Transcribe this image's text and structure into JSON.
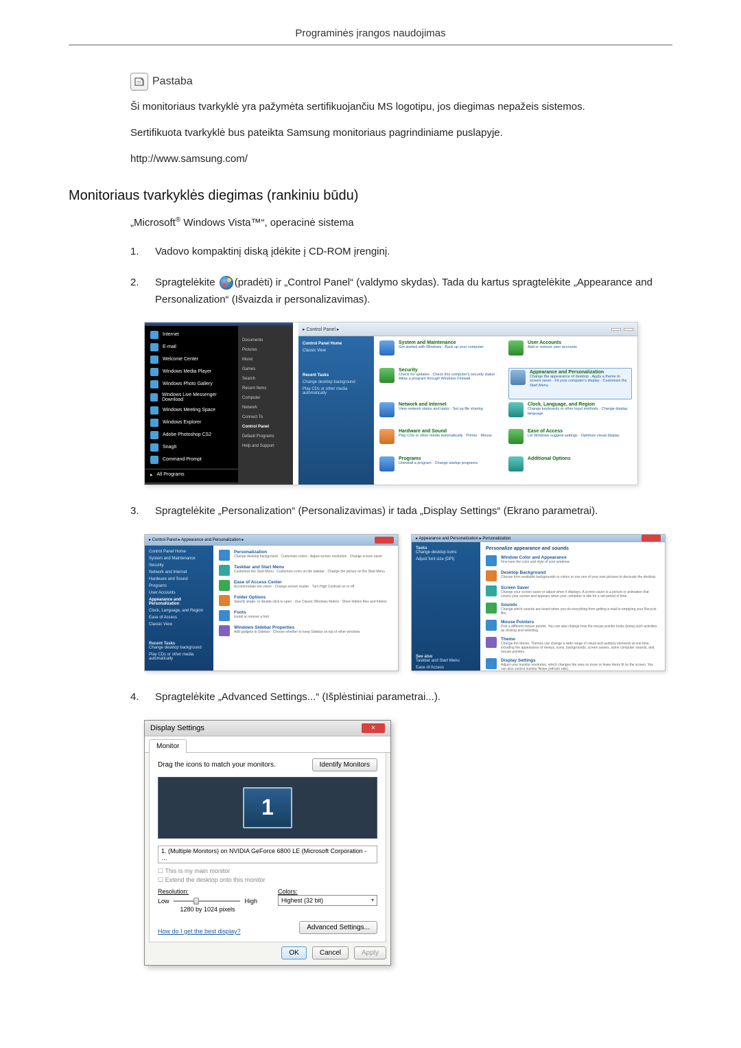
{
  "header": {
    "title": "Programinės įrangos naudojimas"
  },
  "note": {
    "label": "Pastaba",
    "p1": "Ši monitoriaus tvarkyklė yra pažymėta sertifikuojančiu MS logotipu, jos diegimas nepažeis sistemos.",
    "p2": "Sertifikuota tvarkyklė bus pateikta Samsung monitoriaus pagrindiniame puslapyje.",
    "p3": "http://www.samsung.com/"
  },
  "section": {
    "heading": "Monitoriaus tvarkyklės diegimas (rankiniu būdu)",
    "subheading_pre": "„Microsoft",
    "subheading_reg": "®",
    "subheading_mid": " Windows Vista™“, operacinė sistema"
  },
  "steps": {
    "s1": {
      "num": "1.",
      "text": "Vadovo kompaktinį diską įdėkite į CD-ROM įrenginį."
    },
    "s2": {
      "num": "2.",
      "before": "Spragtelėkite ",
      "after": "(pradėti) ir „Control Panel“ (valdymo skydas). Tada du kartus spragtelėkite „Appearance and Personalization“ (Išvaizda ir personalizavimas)."
    },
    "s3": {
      "num": "3.",
      "text": "Spragtelėkite „Personalization“ (Personalizavimas) ir tada „Display Settings“ (Ekrano parametrai)."
    },
    "s4": {
      "num": "4.",
      "text": "Spragtelėkite „Advanced Settings...“ (Išplėstiniai parametrai...)."
    }
  },
  "start_menu": {
    "col1": [
      "Internet",
      "E-mail",
      "Welcome Center",
      "Windows Media Player",
      "Windows Photo Gallery",
      "Windows Live Messenger Download",
      "Windows Meeting Space",
      "Windows Explorer",
      "Adobe Photoshop CS2",
      "SnagIt",
      "Command Prompt"
    ],
    "all": "All Programs",
    "col2": [
      "Documents",
      "Pictures",
      "Music",
      "Games",
      "Search",
      "Recent Items",
      "Computer",
      "Network",
      "Connect To",
      "Control Panel",
      "Default Programs",
      "Help and Support"
    ]
  },
  "cp": {
    "addr": "▸ Control Panel ▸",
    "side_head": "Control Panel Home",
    "side_classic": "Classic View",
    "side_recent": "Recent Tasks",
    "side_recent1": "Change desktop background",
    "side_recent2": "Play CDs or other media automatically",
    "cats": [
      {
        "title": "System and Maintenance",
        "sub": "Get started with Windows · Back up your computer"
      },
      {
        "title": "User Accounts",
        "sub": "Add or remove user accounts"
      },
      {
        "title": "Security",
        "sub": "Check for updates · Check this computer's security status · Allow a program through Windows Firewall"
      },
      {
        "title": "Appearance and Personalization",
        "sub": "Change the appearance of desktop · Apply a theme to screen saver · Fit your computer's display · Customize the Start Menu"
      },
      {
        "title": "Network and Internet",
        "sub": "View network status and tasks · Set up file sharing"
      },
      {
        "title": "Clock, Language, and Region",
        "sub": "Change keyboards or other input methods · Change display language"
      },
      {
        "title": "Hardware and Sound",
        "sub": "Play CDs or other media automatically · Printer · Mouse"
      },
      {
        "title": "Ease of Access",
        "sub": "Let Windows suggest settings · Optimize visual display"
      },
      {
        "title": "Programs",
        "sub": "Uninstall a program · Change startup programs"
      },
      {
        "title": "Additional Options",
        "sub": ""
      }
    ]
  },
  "pers_left": {
    "addr": "▸ Control Panel ▸ Appearance and Personalization ▸",
    "side": [
      "Control Panel Home",
      "System and Maintenance",
      "Security",
      "Network and Internet",
      "Hardware and Sound",
      "Programs",
      "User Accounts",
      "Appearance and Personalization",
      "Clock, Language, and Region",
      "Ease of Access",
      "Classic View"
    ],
    "see_head": "Recent Tasks",
    "see": [
      "Change desktop background",
      "Play CDs or other media automatically"
    ],
    "items": [
      {
        "t": "Personalization",
        "s": "Change desktop background · Customize colors · Adjust screen resolution · Change screen saver"
      },
      {
        "t": "Taskbar and Start Menu",
        "s": "Customize the Start Menu · Customize icons on the taskbar · Change the picture on the Start Menu"
      },
      {
        "t": "Ease of Access Center",
        "s": "Accommodate low vision · Change screen reader · Turn High Contrast on or off"
      },
      {
        "t": "Folder Options",
        "s": "Specify single- or double-click to open · Use Classic Windows folders · Show hidden files and folders"
      },
      {
        "t": "Fonts",
        "s": "Install or remove a font"
      },
      {
        "t": "Windows Sidebar Properties",
        "s": "Add gadgets to Sidebar · Choose whether to keep Sidebar on top of other windows"
      }
    ]
  },
  "pers_right": {
    "addr": "▸ Appearance and Personalization ▸ Personalization",
    "head": "Personalize appearance and sounds",
    "side": [
      "Tasks",
      "Change desktop icons",
      "Adjust font size (DPI)"
    ],
    "see_head": "See also",
    "see": [
      "Taskbar and Start Menu",
      "Ease of Access"
    ],
    "items": [
      {
        "t": "Window Color and Appearance",
        "s": "Fine tune the color and style of your windows."
      },
      {
        "t": "Desktop Background",
        "s": "Choose from available backgrounds or colors or use one of your own pictures to decorate the desktop."
      },
      {
        "t": "Screen Saver",
        "s": "Change your screen saver or adjust when it displays. A screen saver is a picture or animation that covers your screen and appears when your computer is idle for a set period of time."
      },
      {
        "t": "Sounds",
        "s": "Change which sounds are heard when you do everything from getting e-mail to emptying your Recycle Bin."
      },
      {
        "t": "Mouse Pointers",
        "s": "Pick a different mouse pointer. You can also change how the mouse pointer looks during such activities as clicking and selecting."
      },
      {
        "t": "Theme",
        "s": "Change the theme. Themes can change a wide range of visual and auditory elements at one time, including the appearance of menus, icons, backgrounds, screen savers, some computer sounds, and mouse pointers."
      },
      {
        "t": "Display Settings",
        "s": "Adjust your monitor resolution, which changes the view so more or fewer items fit on the screen. You can also control monitor flicker (refresh rate)."
      }
    ]
  },
  "ds": {
    "title": "Display Settings",
    "tab": "Monitor",
    "drag": "Drag the icons to match your monitors.",
    "identify": "Identify Monitors",
    "mon_num": "1",
    "select": "1. (Multiple Monitors) on NVIDIA GeForce 6800 LE (Microsoft Corporation - …",
    "chk1": "This is my main monitor",
    "chk2": "Extend the desktop onto this monitor",
    "res_label": "Resolution:",
    "low": "Low",
    "high": "High",
    "res_value": "1280 by 1024 pixels",
    "col_label": "Colors:",
    "col_value": "Highest (32 bit)",
    "link": "How do I get the best display?",
    "adv": "Advanced Settings...",
    "ok": "OK",
    "cancel": "Cancel",
    "apply": "Apply"
  }
}
